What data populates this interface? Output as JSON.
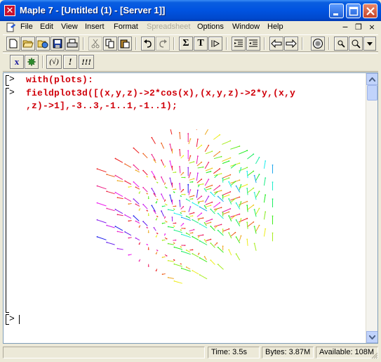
{
  "window": {
    "title": "Maple 7  - [Untitled (1) - [Server 1]]"
  },
  "menu": {
    "items": [
      {
        "label": "File",
        "enabled": true
      },
      {
        "label": "Edit",
        "enabled": true
      },
      {
        "label": "View",
        "enabled": true
      },
      {
        "label": "Insert",
        "enabled": true
      },
      {
        "label": "Format",
        "enabled": true
      },
      {
        "label": "Spreadsheet",
        "enabled": false
      },
      {
        "label": "Options",
        "enabled": true
      },
      {
        "label": "Window",
        "enabled": true
      },
      {
        "label": "Help",
        "enabled": true
      }
    ]
  },
  "toolbar1": {
    "icons": [
      "new-document-icon",
      "open-folder-icon",
      "open-url-icon",
      "save-icon",
      "print-icon",
      "cut-icon",
      "copy-icon",
      "paste-icon",
      "undo-icon",
      "redo-icon",
      "sigma-icon",
      "text-icon",
      "insert-execution-group-icon",
      "outdent-icon",
      "indent-icon",
      "back-icon",
      "forward-icon",
      "stop-icon",
      "zoom-in-icon",
      "zoom-out-icon"
    ],
    "sigma_label": "Σ",
    "text_label": "T"
  },
  "toolbar2": {
    "x_label": "x",
    "check_label": "(√)",
    "exec_label": "!",
    "exec_all_label": "!!!",
    "icons": [
      "math-input-icon",
      "maple-leaf-icon",
      "check-syntax-icon",
      "execute-icon",
      "execute-all-icon"
    ]
  },
  "worksheet": {
    "prompt": ">",
    "lines": [
      "with(plots):",
      "fieldplot3d([(x,y,z)->2*cos(x),(x,y,z)->2*y,(x,y",
      ",z)->1],-3..3,-1..1,-1..1);"
    ],
    "empty_prompt": ">"
  },
  "status": {
    "time": "Time:   3.5s",
    "bytes": "Bytes: 3.87M",
    "available": "Available: 108M"
  },
  "colors": {
    "titlebar": "#0053e0",
    "input_text": "#d0000a",
    "worksheet_bg": "#ffffff"
  }
}
